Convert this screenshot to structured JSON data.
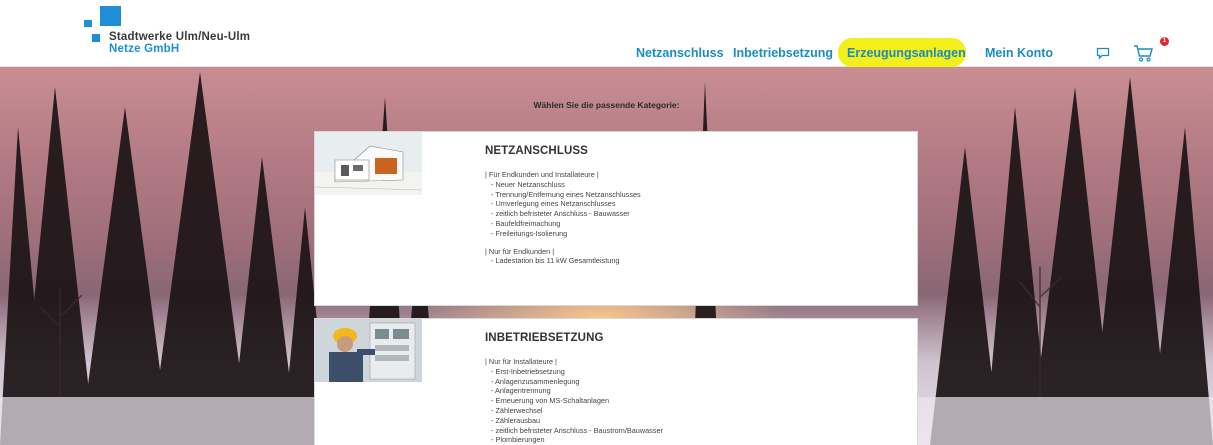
{
  "header": {
    "logo": {
      "line1": "Stadtwerke Ulm/Neu-Ulm",
      "line2": "Netze GmbH"
    },
    "nav": [
      {
        "label": "Netzanschluss"
      },
      {
        "label": "Inbetriebsetzung"
      },
      {
        "label": "Erzeugungsanlagen",
        "highlighted": true
      },
      {
        "label": "Mein Konto"
      }
    ],
    "cart_badge": "1"
  },
  "main": {
    "heading": "Wählen Sie die passende Kategorie:",
    "cards": [
      {
        "title": "NETZANSCHLUSS",
        "groups": [
          {
            "label": "| Für Endkunden und Installateure |",
            "items": [
              "- Neuer Netzanschluss",
              "- Trennung/Entfernung eines Netzanschlusses",
              "- Umverlegung eines Netzanschlusses",
              "- zeitlich befristeter Anschluss - Bauwasser",
              "- Baufeldfreimachung",
              "- Freileitungs-Isolierung"
            ]
          },
          {
            "label": "| Nur für Endkunden |",
            "items": [
              "- Ladestation bis 11 kW Gesamtleistung"
            ]
          }
        ]
      },
      {
        "title": "INBETRIEBSETZUNG",
        "groups": [
          {
            "label": "| Nur für Installateure |",
            "items": [
              "- Erst-Inbetriebsetzung",
              "- Anlagenzusammenlegung",
              "- Anlagentrennung",
              "- Erneuerung von MS-Schaltanlagen",
              "- Zählerwechsel",
              "- Zählerausbau",
              "- zeitlich befristeter Anschluss - Baustrom/Bauwasser",
              "- Plombierungen"
            ]
          }
        ]
      }
    ]
  },
  "colors": {
    "brand": "#1e8fd6",
    "nav_text": "#1a8cc2",
    "highlight": "#f2ef1a",
    "badge": "#e5262c"
  }
}
